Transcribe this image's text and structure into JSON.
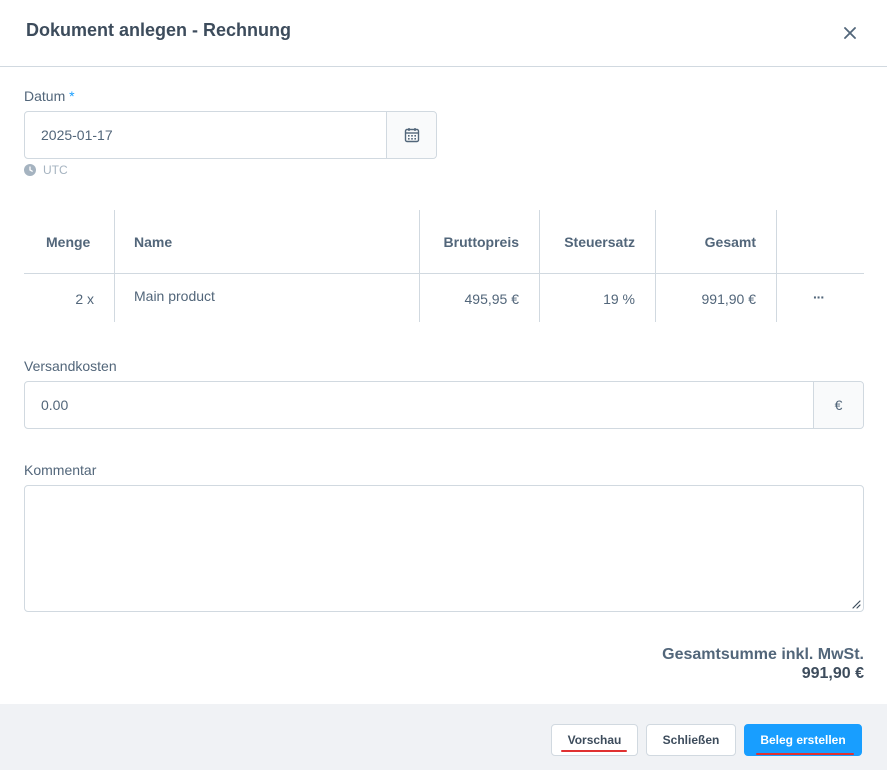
{
  "modal": {
    "title": "Dokument anlegen - Rechnung"
  },
  "date_field": {
    "label": "Datum",
    "required_marker": "*",
    "value": "2025-01-17",
    "timezone": "UTC"
  },
  "line_items": {
    "columns": [
      "Menge",
      "Name",
      "Bruttopreis",
      "Steuersatz",
      "Gesamt"
    ],
    "rows": [
      {
        "quantity": "2 x",
        "name": "Main product",
        "gross_price": "495,95 €",
        "tax_rate": "19 %",
        "total": "991,90 €",
        "actions": "···"
      }
    ]
  },
  "shipping": {
    "label": "Versandkosten",
    "value": "0.00",
    "currency": "€"
  },
  "comment": {
    "label": "Kommentar",
    "value": ""
  },
  "summary": {
    "label": "Gesamtsumme inkl. MwSt.",
    "value": "991,90 €"
  },
  "footer": {
    "preview_label": "Vorschau",
    "close_label": "Schließen",
    "create_label": "Beleg erstellen"
  },
  "colors": {
    "accent": "#189eff",
    "text": "#52667a",
    "border": "#d1d9e0",
    "footer_bg": "#f0f2f5",
    "highlight": "#e03131"
  }
}
